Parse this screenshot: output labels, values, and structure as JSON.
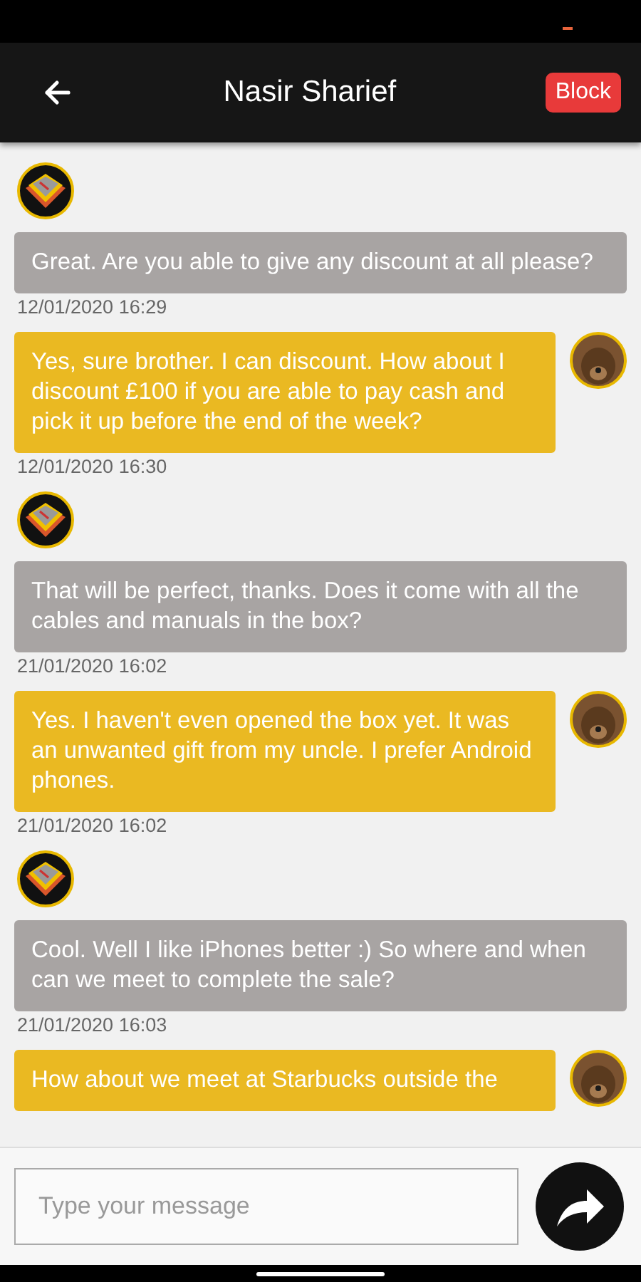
{
  "header": {
    "title": "Nasir Sharief",
    "block_button": "Block"
  },
  "messages": [
    {
      "kind": "received",
      "text": "Great. Are you able to give any discount at all please?",
      "time": "12/01/2020 16:29"
    },
    {
      "kind": "sent",
      "text": "Yes, sure brother. I can discount. How about I discount £100 if you are able to pay cash and pick it up before the end of the week?",
      "time": "12/01/2020 16:30"
    },
    {
      "kind": "received",
      "text": "That will be perfect, thanks. Does it come with all the cables and manuals in the box?",
      "time": "21/01/2020 16:02"
    },
    {
      "kind": "sent",
      "text": "Yes. I haven't even opened the box yet. It was an unwanted gift from my uncle. I prefer Android phones.",
      "time": "21/01/2020 16:02"
    },
    {
      "kind": "received",
      "text": "Cool. Well I like iPhones better :) So where and when can we meet to complete the sale?",
      "time": "21/01/2020 16:03"
    },
    {
      "kind": "sent",
      "text": "How about we meet at Starbucks outside the"
    }
  ],
  "composer": {
    "placeholder": "Type your message"
  }
}
